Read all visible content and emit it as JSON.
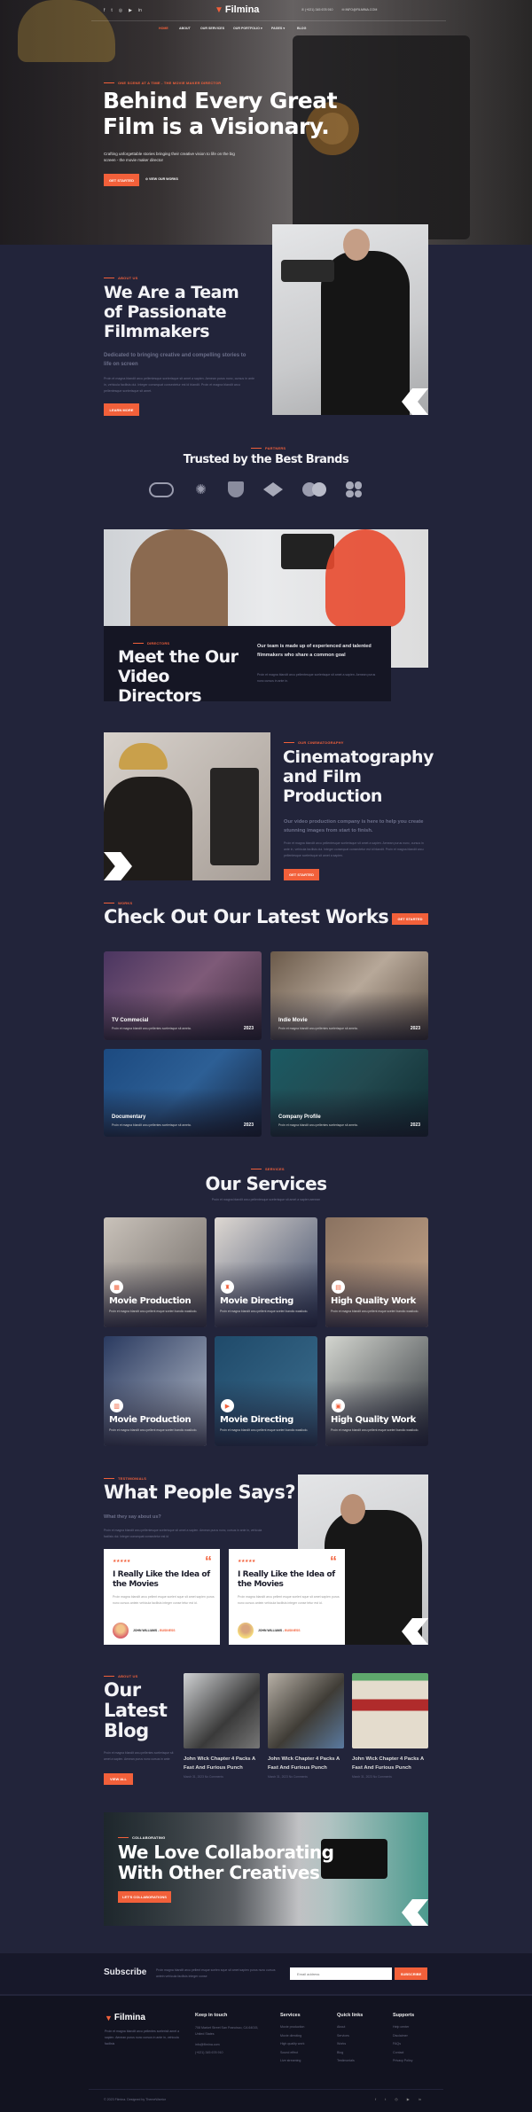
{
  "header": {
    "logo": "Filmina",
    "phone": "(+021) 345 678 910",
    "email": "INFO@FILMINA.COM",
    "social": [
      "facebook-icon",
      "twitter-icon",
      "instagram-icon",
      "youtube-icon",
      "linkedin-icon"
    ],
    "nav": [
      "HOME",
      "ABOUT",
      "OUR SERVICES",
      "OUR PORTFOLIO",
      "PAGES",
      "BLOG"
    ],
    "active_nav": "HOME"
  },
  "hero": {
    "eyebrow": "ONE SCENE AT A TIME - THE MOVIE MAKER DIRECTOR",
    "title_line1": "Behind Every Great",
    "title_line2": "Film is a Visionary.",
    "text": "Crafting unforgettable stories bringing their creative vision to life on the big screen - the movie maker director",
    "primary_button": "GET STARTED",
    "secondary_button": "VIEW OUR WORKS"
  },
  "about": {
    "eyebrow": "ABOUT US",
    "title": "We Are a Team of Passionate Filmmakers",
    "subtitle": "Dedicated to bringing creative and compelling stories to life on screen",
    "text": "Proin et magna blandit arcu pellentesque scelerisque sit amet a sapien. Aenean purus nunc, cursus in ante in, vehicula facilisis dui. Integer consequat consectetur est id blandit. Proin et magna blandit arcu pellentesque scelerisque sit amet.",
    "button": "LEARN MORE"
  },
  "partners": {
    "eyebrow": "PARTNERS",
    "title": "Trusted by the Best Brands",
    "logos": [
      "brand-logo-1",
      "brand-logo-2",
      "brand-logo-3",
      "brand-logo-4",
      "brand-logo-5",
      "brand-logo-6"
    ]
  },
  "directors": {
    "eyebrow": "DIRECTORS",
    "title": "Meet the Our Video Directors",
    "subtitle": "Our team is made up of experienced and talented filmmakers who share a common goal",
    "text": "Proin et magna blandit arcu pellentesque scelerisque sit amet a sapien. Aenean purus nunc cursus in ante in."
  },
  "cinema": {
    "eyebrow": "OUR CINEMATOGRAPHY",
    "title": "Cinematography and Film Production",
    "subtitle": "Our video production company is here to help you create stunning images from start to finish.",
    "text": "Proin et magna blandit arcu pellentesque scelerisque sit amet a sapien. Aenean purus nunc, cursus in ante in, vehicula facilisis dui. Integer consequat consectetur est id blandit. Proin et magna blandit arcu pellentesque scelerisque sit amet a sapien.",
    "button": "GET STARTED"
  },
  "works": {
    "eyebrow": "WORKS",
    "title": "Check Out Our Latest Works",
    "button": "GET STARTED",
    "items": [
      {
        "title": "TV Commecial",
        "text": "Proin et magna blandit arcu pellentes scelerisque sit ameta.",
        "year": "2023"
      },
      {
        "title": "Indie Movie",
        "text": "Proin et magna blandit arcu pellentes scelerisque sit ameta.",
        "year": "2023"
      },
      {
        "title": "Documentary",
        "text": "Proin et magna blandit arcu pellentes scelerisque sit ameta.",
        "year": "2023"
      },
      {
        "title": "Company Profile",
        "text": "Proin et magna blandit arcu pellentes scelerisque sit ameta.",
        "year": "2023"
      }
    ]
  },
  "services": {
    "eyebrow": "SERVICES",
    "title": "Our Services",
    "subtitle": "Proin et magna blandit arcu pellentesque scelerisque sit amet a sapien aenean",
    "items": [
      {
        "title": "Movie Production",
        "text": "Proin et magna blandit arcu pellent esque sceleri bandio wasikolo.",
        "icon": "calendar-icon"
      },
      {
        "title": "Movie Directing",
        "text": "Proin et magna blandit arcu pellent esque sceleri bandio wasikolo.",
        "icon": "director-icon"
      },
      {
        "title": "High Quality Work",
        "text": "Proin et magna blandit arcu pellent esque sceleri bandio wasikolo.",
        "icon": "film-icon"
      },
      {
        "title": "Movie Production",
        "text": "Proin et magna blandit arcu pellent esque sceleri bandio wasikolo.",
        "icon": "document-icon"
      },
      {
        "title": "Movie Directing",
        "text": "Proin et magna blandit arcu pellent esque sceleri bandio wasikolo.",
        "icon": "video-icon"
      },
      {
        "title": "High Quality Work",
        "text": "Proin et magna blandit arcu pellent esque sceleri bandio wasikolo.",
        "icon": "gift-icon"
      }
    ]
  },
  "testimonials": {
    "eyebrow": "TESTIMONIALS",
    "title": "What People Says?",
    "subtitle": "What they say about us?",
    "text": "Proin et magna blandit arcu pellentesque scelerisque sit amet a sapien. Aenean purus nunc, cursus in ante in, vehicula facilisis dui. Integer consequat consectetur est id",
    "items": [
      {
        "rating": 5,
        "title": "I Really Like the Idea of the Movies",
        "text": "Proin magna blandit arcu pellent esque sceleri sque sit amet sapien purus nunc cursus antein vehicula facilisis integer conse tetur est id.",
        "name": "JOHN WILLIAMS",
        "role": "BUSINESS"
      },
      {
        "rating": 5,
        "title": "I Really Like the Idea of the Movies",
        "text": "Proin magna blandit arcu pellent esque sceleri sque sit amet sapien purus nunc cursus antein vehicula facilisis integer conse tetur est id.",
        "name": "JOHN WILLIAMS",
        "role": "BUSINESS"
      }
    ]
  },
  "blog": {
    "eyebrow": "ABOUT US",
    "title": "Our Latest Blog",
    "text": "Proin et magna blandit arcu pellentes scelerisque sit amet a sapien. Aenean purus nunc cursus in ante",
    "button": "VIEW ALL",
    "posts": [
      {
        "title": "John Wick Chapter 4 Packs A Fast And Furious Punch",
        "meta": "March 31, 2023 No Comments"
      },
      {
        "title": "John Wick Chapter 4 Packs A Fast And Furious Punch",
        "meta": "March 31, 2023 No Comments"
      },
      {
        "title": "John Wick Chapter 4 Packs A Fast And Furious Punch",
        "meta": "March 31, 2023 No Comments"
      }
    ]
  },
  "collab": {
    "eyebrow": "COLLABORATING",
    "title_line1": "We Love Collaborating",
    "title_line2": "With Other Creatives",
    "button": "LET'S COLLABORATIONS"
  },
  "subscribe": {
    "title": "Subscribe",
    "text": "Proin magna blandit arcu pellent esque scelen sque sit amet sapien purus nunc cursus antein vehicula facilisis integer conse",
    "placeholder": "Email address",
    "button": "SUBSCRIBE"
  },
  "footer": {
    "logo": "Filmina",
    "about": "Proin et magna blandit arcu pellentes scelerisit amet a sapien. Aenean purus nunc cursus in ante in, vehicula facilisis",
    "contact": {
      "title": "Keep in touch",
      "address": "708 Market Street San Francisco, CA 64015, United States",
      "email": "info@filmina.com",
      "phone": "(+021) 345 678 910"
    },
    "services": {
      "title": "Services",
      "links": [
        "Movie production",
        "Movie directing",
        "High quality work",
        "Sound effect",
        "Live streaming"
      ]
    },
    "quick": {
      "title": "Quick links",
      "links": [
        "About",
        "Services",
        "Works",
        "Blog",
        "Testimonials"
      ]
    },
    "supports": {
      "title": "Supports",
      "links": [
        "Help center",
        "Disclaimer",
        "FAQs",
        "Contact",
        "Privacy Policy"
      ]
    },
    "copyright": "© 2023 Filmina. Designed by ThemeWarrior"
  },
  "colors": {
    "accent": "#f2603a",
    "background": "#22243a",
    "footer": "#121320"
  }
}
